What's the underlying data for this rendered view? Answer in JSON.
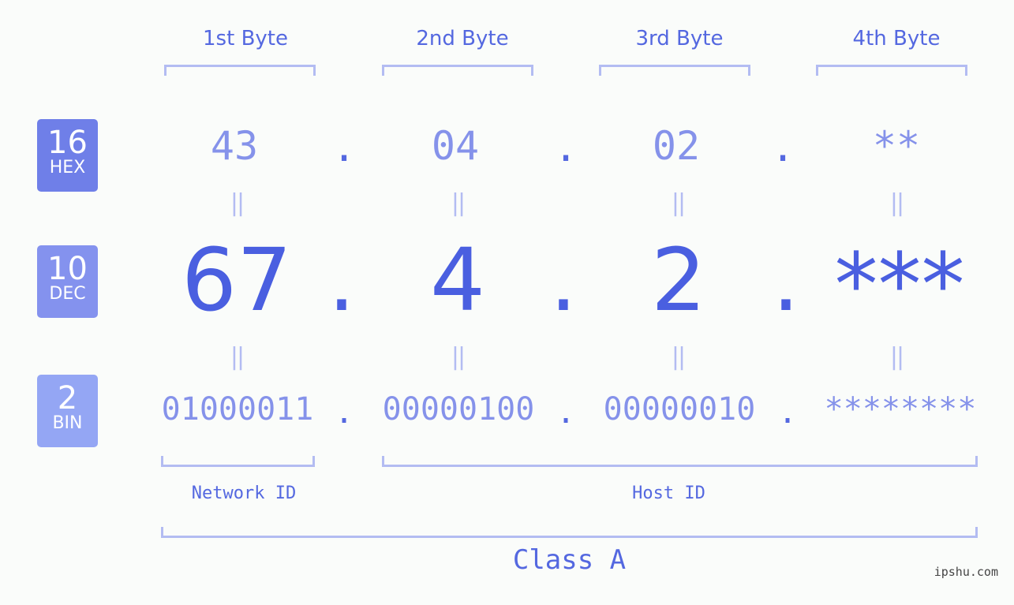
{
  "byte_headers": [
    "1st Byte",
    "2nd Byte",
    "3rd Byte",
    "4th Byte"
  ],
  "badges": {
    "hex": {
      "number": "16",
      "base": "HEX",
      "color": "#6f7fe8"
    },
    "dec": {
      "number": "10",
      "base": "DEC",
      "color": "#8492ee"
    },
    "bin": {
      "number": "2",
      "base": "BIN",
      "color": "#94a6f4"
    }
  },
  "hex_values": [
    "43",
    "04",
    "02",
    "**"
  ],
  "dec_values": [
    "67",
    "4",
    "2",
    "***"
  ],
  "bin_values": [
    "01000011",
    "00000100",
    "00000010",
    "********"
  ],
  "separator": ".",
  "equals_symbol": "||",
  "network_id_label": "Network ID",
  "host_id_label": "Host ID",
  "class_label": "Class A",
  "watermark": "ipshu.com",
  "colors": {
    "accent": "#4a5fe0",
    "light_accent": "#8592ea",
    "bracket": "#b3bcf2"
  }
}
